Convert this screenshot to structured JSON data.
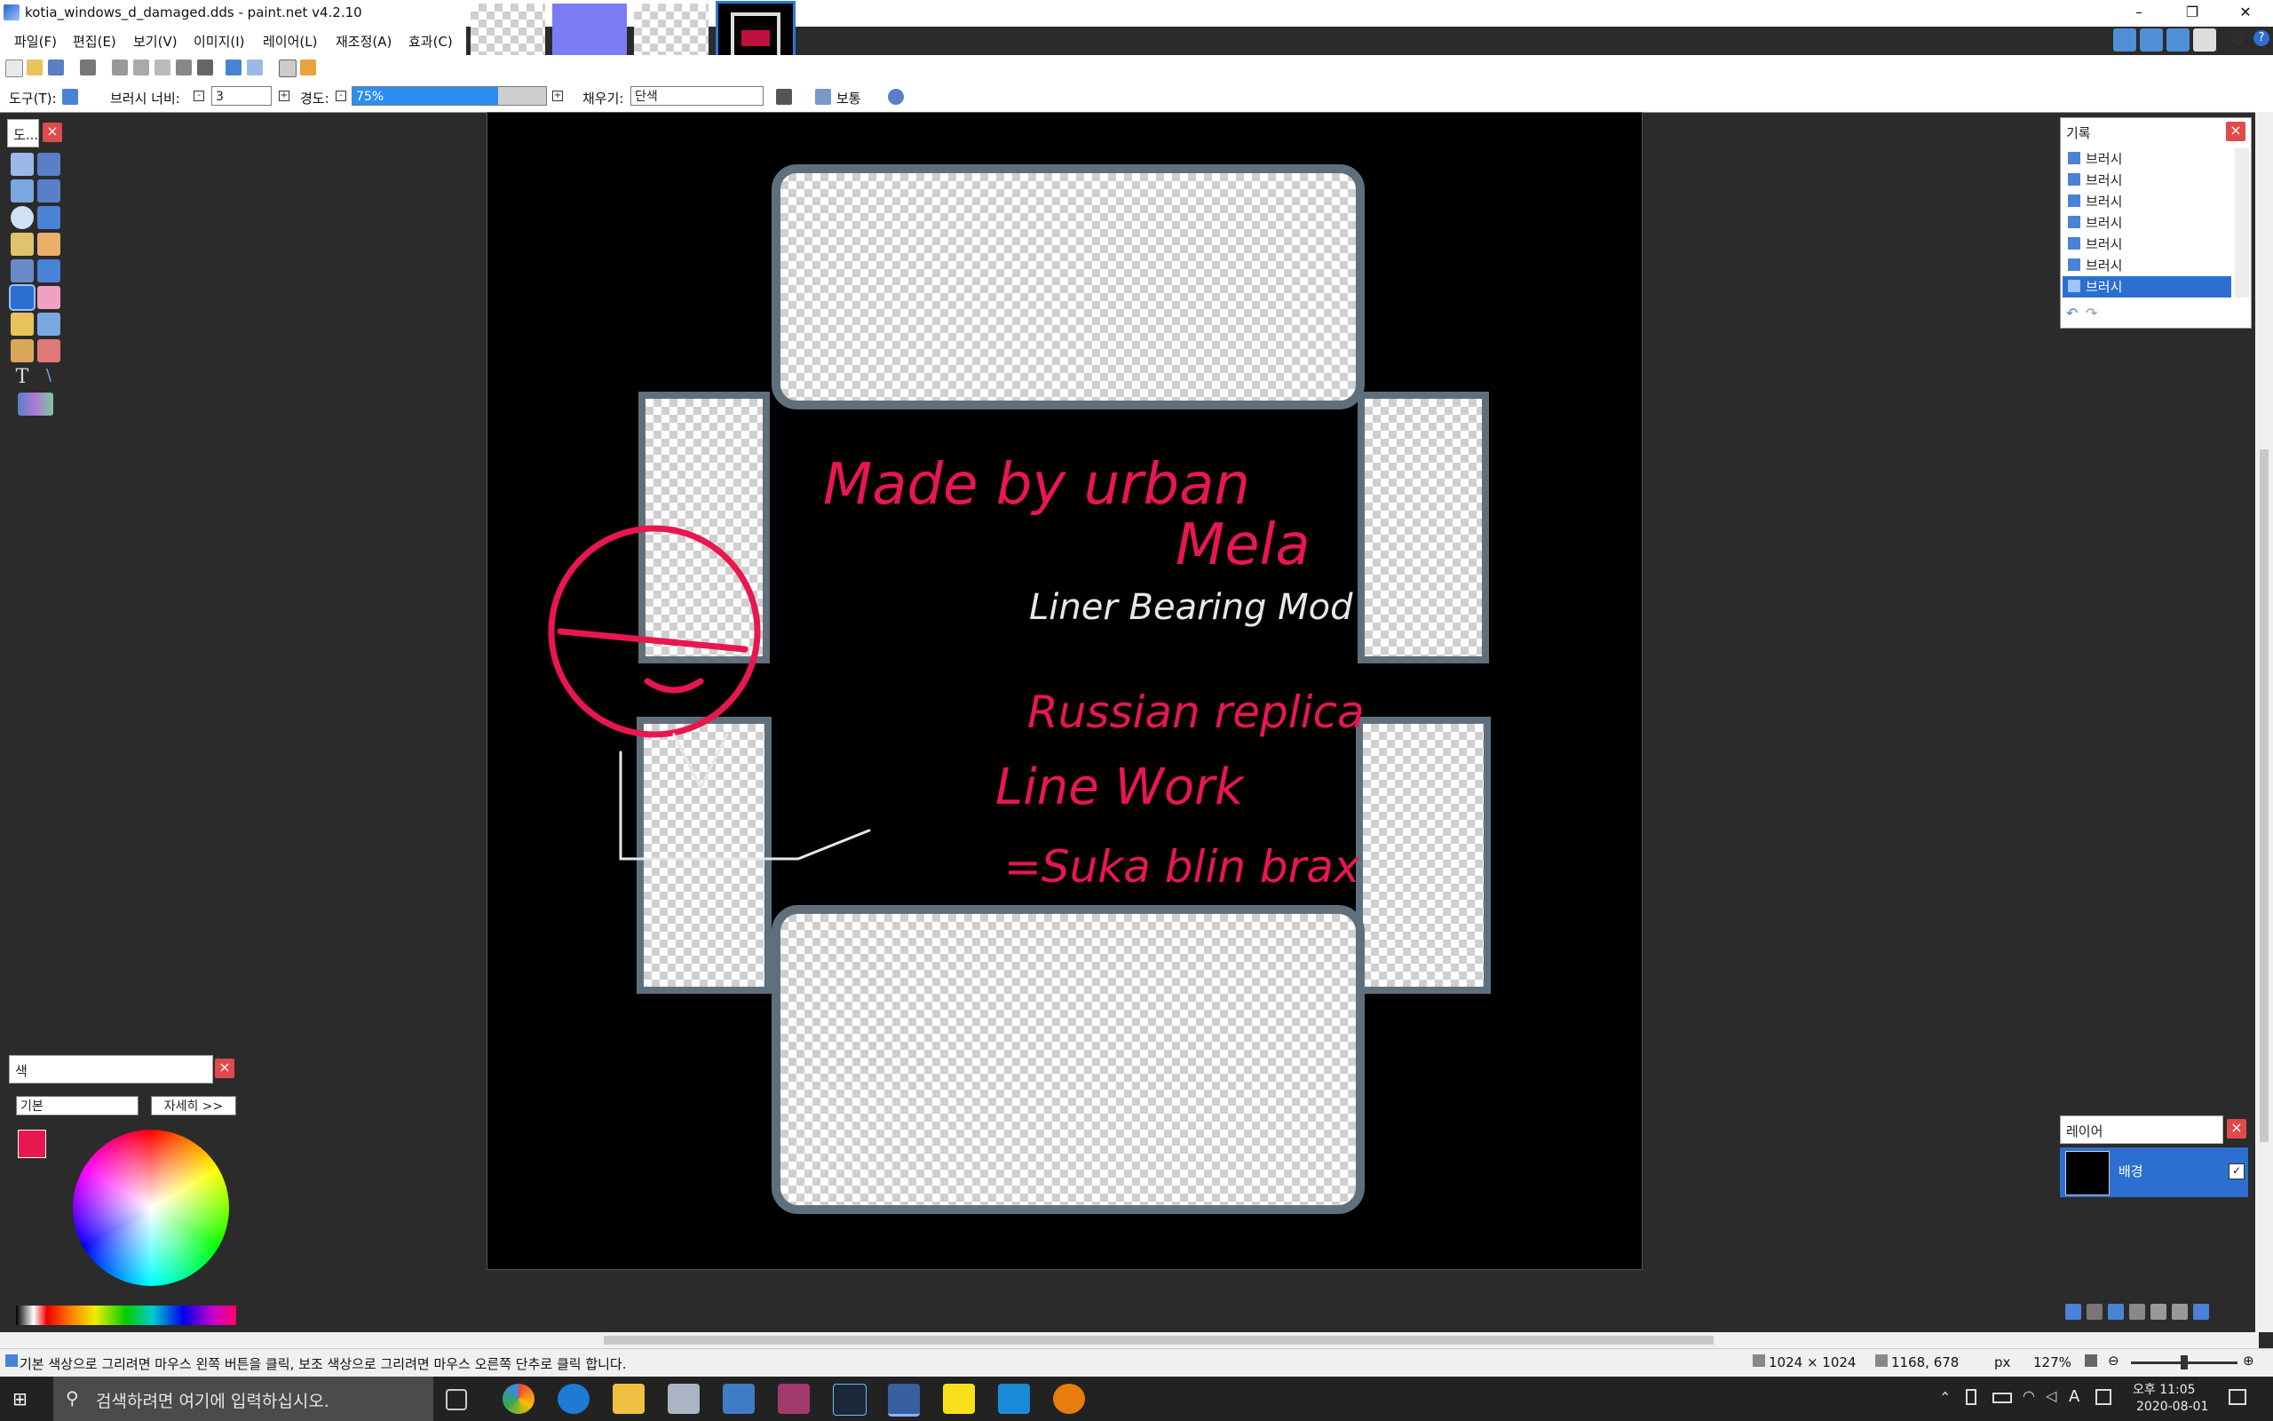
{
  "window": {
    "title": "kotia_windows_d_damaged.dds - paint.net v4.2.10",
    "controls": {
      "minimize": "–",
      "maximize": "❐",
      "close": "✕"
    }
  },
  "menu": [
    "파일(F)",
    "편집(E)",
    "보기(V)",
    "이미지(I)",
    "레이어(L)",
    "재조정(A)",
    "효과(C)"
  ],
  "toolbar_row2": {
    "tool_label": "도구(T):",
    "brush_width_label": "브러시 너비:",
    "brush_width_value": "3",
    "hardness_label": "경도:",
    "hardness_value": "75%",
    "hardness_fraction": 0.75,
    "fill_label": "채우기:",
    "fill_value": "단색",
    "blend_mode": "보통"
  },
  "tools_panel": {
    "title": "도..."
  },
  "history": {
    "title": "기록",
    "items": [
      "브러시",
      "브러시",
      "브러시",
      "브러시",
      "브러시",
      "브러시",
      "브러시"
    ],
    "selected_index": 6
  },
  "colors_panel": {
    "title": "색",
    "palette_select": "기본",
    "more_button": "자세히 >>",
    "primary_color": "#e8174f",
    "secondary_color": "#ffffff"
  },
  "layers_panel": {
    "title": "레이어",
    "layers": [
      {
        "name": "배경",
        "visible": true
      }
    ]
  },
  "status": {
    "hint": "기본 색상으로 그리려면 마우스 왼쪽 버튼을 클릭, 보조 색상으로 그리려면 마우스 오른쪽 단추로 클릭 합니다.",
    "image_size": "1024 × 1024",
    "cursor_pos": "1168, 678",
    "units": "px",
    "zoom": "127%"
  },
  "canvas_art": {
    "text_lines": [
      "Made by urban",
      "Mela",
      "Liner Bearing Mod",
      "Russian replica",
      "Line Work",
      "=Suka blin brax"
    ]
  },
  "taskbar": {
    "search_placeholder": "검색하려면 여기에 입력하십시오.",
    "time": "오후 11:05",
    "date": "2020-08-01",
    "ime": "A"
  },
  "colors": {
    "accent": "#2d6fd0",
    "brush_red": "#e8174f"
  }
}
